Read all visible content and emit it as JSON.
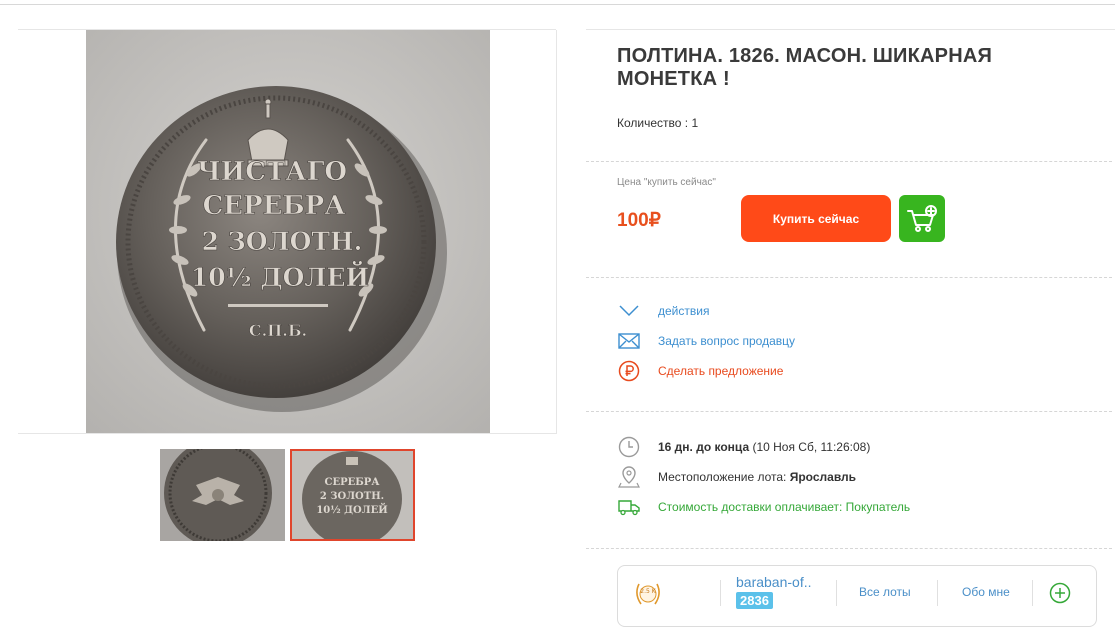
{
  "lot": {
    "title": "ПОЛТИНА. 1826. МАСОН. ШИКАРНАЯ МОНЕТКА !",
    "quantity": "Количество : 1",
    "main_image_alt": "coin reverse photo",
    "coin_legend": [
      "ЧИСТАГО",
      "СЕРЕБРА",
      "2 ЗОЛОТН.",
      "10½ ДОЛЕЙ",
      "С.П.Б."
    ],
    "thumbnails": [
      {
        "name": "obverse",
        "selected": false
      },
      {
        "name": "reverse",
        "selected": true
      }
    ]
  },
  "price": {
    "label": "Цена \"купить сейчас\"",
    "value": "100₽",
    "buy_label": "Купить сейчас",
    "color": "#e8501e",
    "buy_color": "#ff4a18",
    "cart_color": "#38b51f"
  },
  "actions": [
    {
      "icon": "chevron-down-icon",
      "label": "действия",
      "color": "#3d8fd0"
    },
    {
      "icon": "envelope-icon",
      "label": "Задать вопрос продавцу",
      "color": "#3d8fd0"
    },
    {
      "icon": "ruble-icon",
      "label": "Сделать предложение",
      "color": "#e84a1e"
    }
  ],
  "info": {
    "time_bold": "16 дн. до конца",
    "time_rest": " (10 Ноя Сб, 11:26:08)",
    "location_label": "Местоположение лота: ",
    "location_value": "Ярославль",
    "shipping": "Стоимость доставки оплачивает: Покупатель",
    "shipping_color": "#35a838"
  },
  "seller": {
    "badge": "2.5 K",
    "name": "baraban-of..",
    "rating": "2836",
    "all_lots": "Все лоты",
    "about": "Обо мне"
  }
}
